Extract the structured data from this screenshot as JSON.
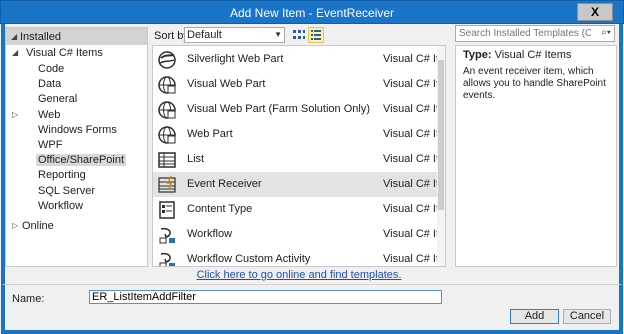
{
  "window": {
    "title": "Add New Item - EventReceiver",
    "close_glyph": "X"
  },
  "tree": {
    "installed_label": "Installed",
    "visual_csharp_label": "Visual C# Items",
    "children": [
      "Code",
      "Data",
      "General",
      "Web",
      "Windows Forms",
      "WPF",
      "Office/SharePoint",
      "Reporting",
      "SQL Server",
      "Workflow"
    ],
    "selected": "Office/SharePoint",
    "online_label": "Online"
  },
  "toolbar": {
    "sortby_label": "Sort by:",
    "sort_value": "Default"
  },
  "search": {
    "placeholder": "Search Installed Templates (Ctrl+E)"
  },
  "templates": [
    {
      "name": "Silverlight Web Part",
      "category": "Visual C# Items",
      "icon": "silverlight-webpart-icon"
    },
    {
      "name": "Visual Web Part",
      "category": "Visual C# Items",
      "icon": "visual-webpart-icon"
    },
    {
      "name": "Visual Web Part (Farm Solution Only)",
      "category": "Visual C# Items",
      "icon": "visual-webpart-farm-icon"
    },
    {
      "name": "Web Part",
      "category": "Visual C# Items",
      "icon": "webpart-icon"
    },
    {
      "name": "List",
      "category": "Visual C# Items",
      "icon": "list-icon"
    },
    {
      "name": "Event Receiver",
      "category": "Visual C# Items",
      "icon": "event-receiver-icon"
    },
    {
      "name": "Content Type",
      "category": "Visual C# Items",
      "icon": "content-type-icon"
    },
    {
      "name": "Workflow",
      "category": "Visual C# Items",
      "icon": "workflow-icon"
    },
    {
      "name": "Workflow Custom Activity",
      "category": "Visual C# Items",
      "icon": "workflow-activity-icon"
    }
  ],
  "selected_template": "Event Receiver",
  "online_link": "Click here to go online and find templates.",
  "info": {
    "type_label": "Type:",
    "type_value": "Visual C# Items",
    "description": "An event receiver item, which allows you to handle SharePoint events."
  },
  "name_field": {
    "label": "Name:",
    "value": "ER_ListItemAddFilter"
  },
  "buttons": {
    "add": "Add",
    "cancel": "Cancel"
  },
  "colors": {
    "title_bar": "#1a75c8",
    "selection": "#e3e3e3",
    "link": "#1e4fb7"
  }
}
